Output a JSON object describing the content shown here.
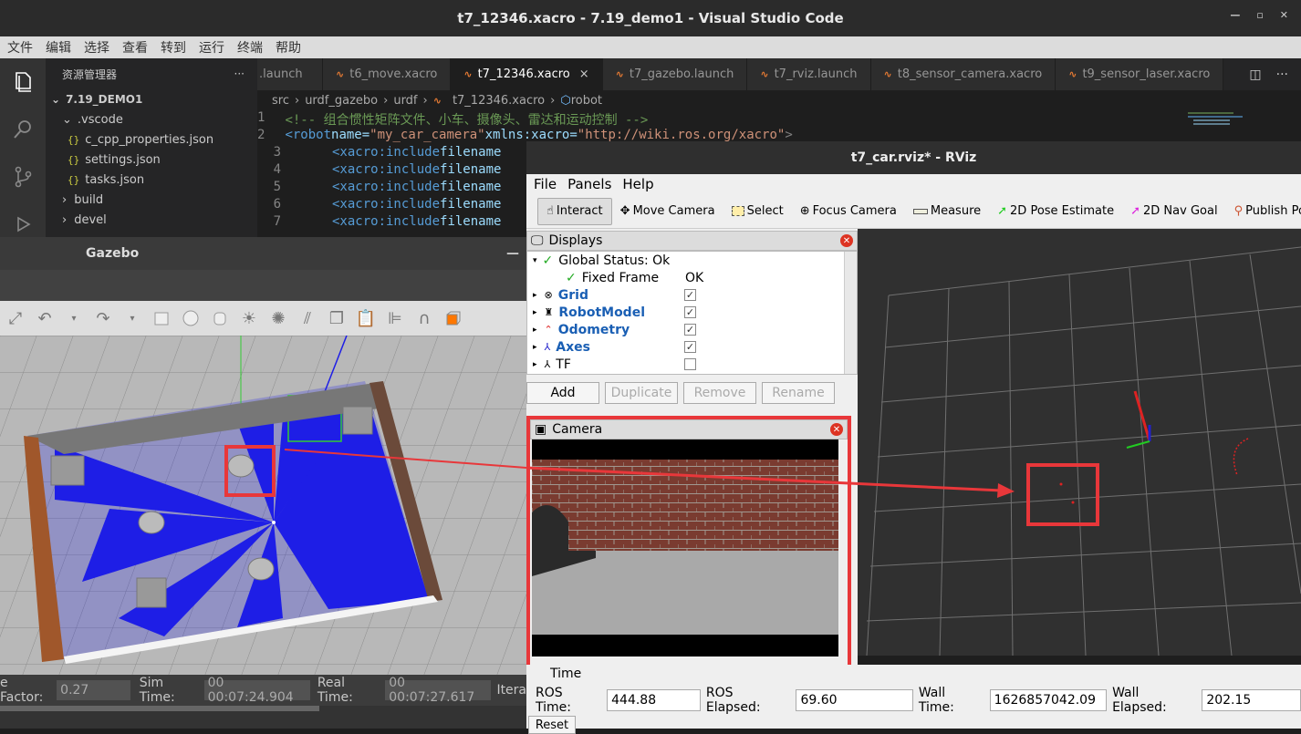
{
  "vscode": {
    "title": "t7_12346.xacro - 7.19_demo1 - Visual Studio Code",
    "menu": [
      "文件",
      "编辑",
      "选择",
      "查看",
      "转到",
      "运行",
      "终端",
      "帮助"
    ],
    "explorer": {
      "header": "资源管理器",
      "more": "···",
      "root": "7.19_DEMO1",
      "vscode_folder": ".vscode",
      "files": [
        "c_cpp_properties.json",
        "settings.json",
        "tasks.json"
      ],
      "folders": [
        "build",
        "devel"
      ]
    },
    "tabs": [
      ".launch",
      "t6_move.xacro",
      "t7_12346.xacro",
      "t7_gazebo.launch",
      "t7_rviz.launch",
      "t8_sensor_camera.xacro",
      "t9_sensor_laser.xacro"
    ],
    "active_tab_close": "×",
    "breadcrumb": [
      "src",
      "urdf_gazebo",
      "urdf",
      "t7_12346.xacro",
      "robot"
    ],
    "code": {
      "line1_num": "1",
      "line1": "<!-- 组合惯性矩阵文件、小车、摄像头、雷达和运动控制 -->",
      "line2_num": "2",
      "line2_tag": "<robot",
      "line2_attr1": " name=",
      "line2_val1": "\"my_car_camera\"",
      "line2_attr2": " xmlns:xacro=",
      "line2_val2": "\"http://wiki.ros.org/xacro\"",
      "line2_end": ">",
      "inc_tag": "<xacro:include",
      "inc_attr": " filename",
      "nums": [
        "3",
        "4",
        "5",
        "6",
        "7"
      ]
    }
  },
  "gazebo": {
    "title": "Gazebo",
    "status": {
      "factor_label": "e Factor:",
      "factor": "0.27",
      "sim_label": "Sim Time:",
      "sim": "00 00:07:24.904",
      "real_label": "Real Time:",
      "real": "00 00:07:27.617",
      "iter_label": "Itera"
    }
  },
  "rviz": {
    "title": "t7_car.rviz* - RViz",
    "menu": [
      "File",
      "Panels",
      "Help"
    ],
    "tools": [
      "Interact",
      "Move Camera",
      "Select",
      "Focus Camera",
      "Measure",
      "2D Pose Estimate",
      "2D Nav Goal",
      "Publish Point"
    ],
    "displays": {
      "title": "Displays",
      "global_status": "Global Status: Ok",
      "fixed_frame": "Fixed Frame",
      "fixed_frame_value": "OK",
      "items": [
        {
          "name": "Grid",
          "checked": true
        },
        {
          "name": "RobotModel",
          "checked": true
        },
        {
          "name": "Odometry",
          "checked": true
        },
        {
          "name": "Axes",
          "checked": true
        },
        {
          "name": "TF",
          "checked": false
        }
      ]
    },
    "buttons": [
      "Add",
      "Duplicate",
      "Remove",
      "Rename"
    ],
    "camera_title": "Camera",
    "time": {
      "title": "Time",
      "ros_time_label": "ROS Time:",
      "ros_time": "444.88",
      "ros_elapsed_label": "ROS Elapsed:",
      "ros_elapsed": "69.60",
      "wall_time_label": "Wall Time:",
      "wall_time": "1626857042.09",
      "wall_elapsed_label": "Wall Elapsed:",
      "wall_elapsed": "202.15",
      "reset": "Reset"
    },
    "colors": {
      "highlight": "#e8373a",
      "laser": "#1e1ee6"
    }
  }
}
